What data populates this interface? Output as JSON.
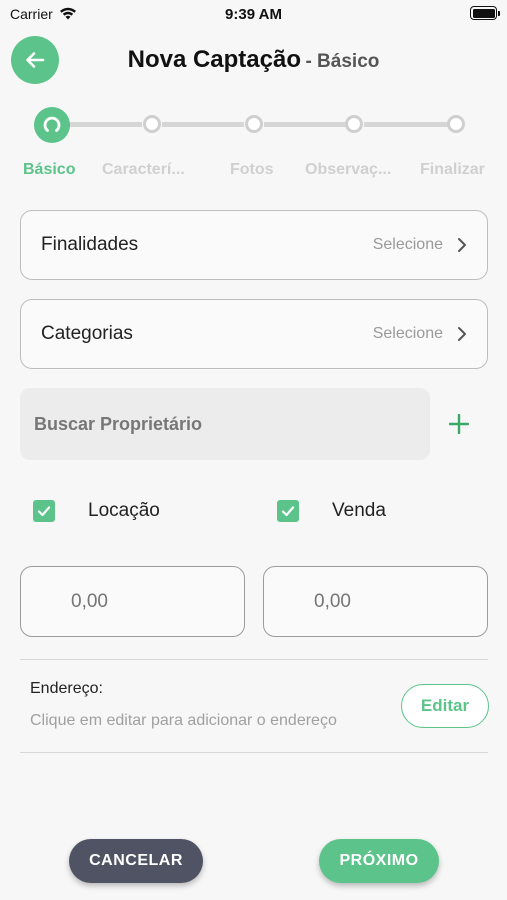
{
  "status_bar": {
    "carrier": "Carrier",
    "time": "9:39 AM"
  },
  "header": {
    "title": "Nova Captação",
    "subtitle": "- Básico"
  },
  "stepper": {
    "steps": [
      {
        "label": "Básico",
        "active": true
      },
      {
        "label": "Caracterí...",
        "active": false
      },
      {
        "label": "Fotos",
        "active": false
      },
      {
        "label": "Observaç...",
        "active": false
      },
      {
        "label": "Finalizar",
        "active": false
      }
    ]
  },
  "form": {
    "finalidades": {
      "label": "Finalidades",
      "hint": "Selecione"
    },
    "categorias": {
      "label": "Categorias",
      "hint": "Selecione"
    },
    "search": {
      "placeholder": "Buscar Proprietário"
    },
    "checkboxes": [
      {
        "label": "Locação",
        "checked": true
      },
      {
        "label": "Venda",
        "checked": true
      }
    ],
    "values": [
      {
        "placeholder": "0,00"
      },
      {
        "placeholder": "0,00"
      }
    ],
    "address": {
      "label": "Endereço:",
      "hint": "Clique em editar para adicionar o endereço",
      "edit_label": "Editar"
    }
  },
  "footer": {
    "cancel_label": "CANCELAR",
    "next_label": "PRÓXIMO"
  },
  "colors": {
    "accent": "#5cc48a",
    "cancel": "#4f5364",
    "background": "#f7f7f7"
  }
}
